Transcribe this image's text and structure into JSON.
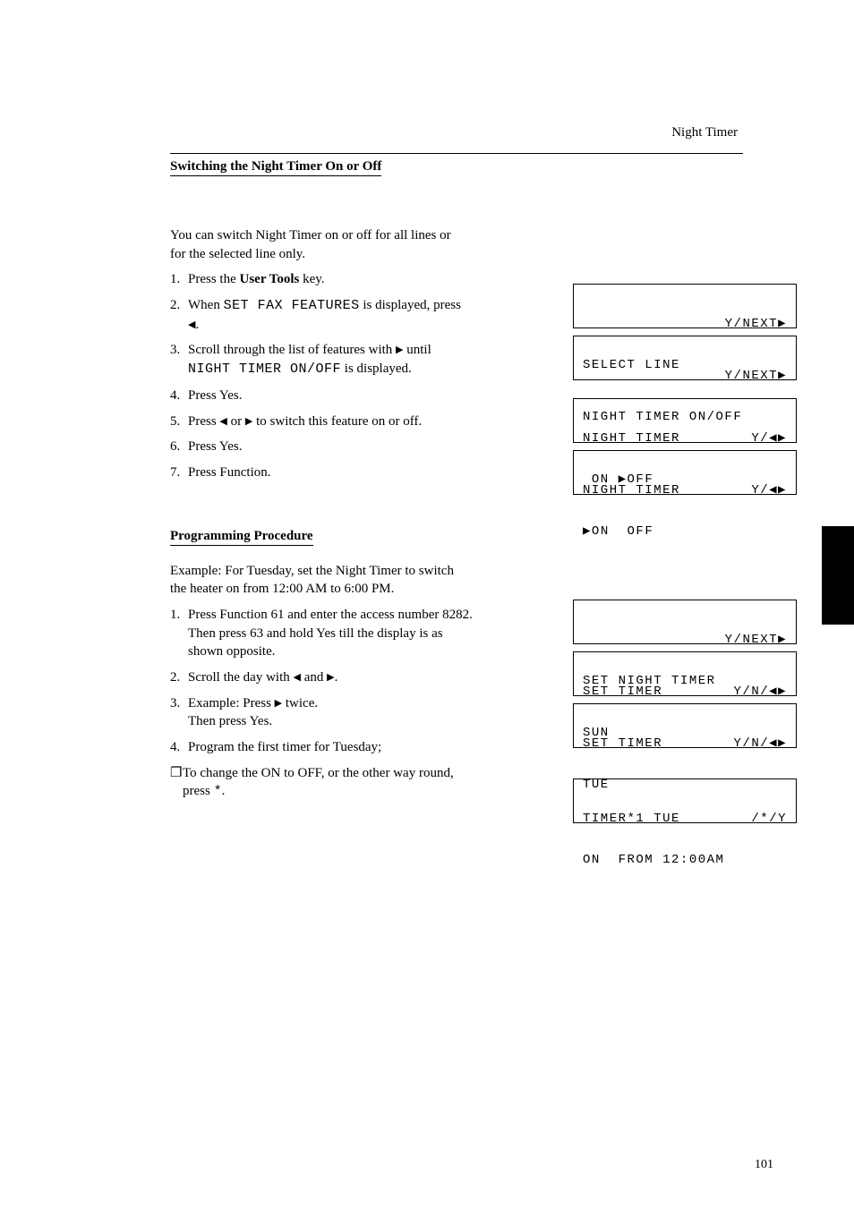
{
  "header": {
    "title": "Night Timer"
  },
  "section1": {
    "label": "Switching the Night Timer On or Off",
    "intro": "You can switch Night Timer on or off for all lines or for the selected line only.",
    "steps": [
      {
        "num": "1.",
        "text_before": "Press the ",
        "bold": "User Tools",
        "text_after": " key."
      },
      {
        "num": "2.",
        "text_pre": "When ",
        "mono": "SET FAX FEATURES",
        "text_mid": " is displayed, press ",
        "arrow": "◀",
        "text_post": "."
      },
      {
        "num": "3.",
        "s3a": "Scroll through the list of features with",
        "s3b": " until ",
        "s3mono": "NIGHT TIMER ON/OFF",
        "s3c": " is displayed."
      },
      {
        "num": "4.",
        "text": "Press Yes."
      },
      {
        "num": "5.",
        "pre": "Press ",
        "a1": "◀",
        "mid1": " or ",
        "a2": "▶",
        "post": " to switch this feature on or off."
      },
      {
        "num": "6.",
        "text": "Press Yes."
      },
      {
        "num": "7.",
        "text": "Press Function."
      }
    ]
  },
  "lcds1": [
    {
      "r1_right": "Y/NEXT▶",
      "r2_left": "SELECT LINE"
    },
    {
      "r1_right": "Y/NEXT▶",
      "r2_left": "NIGHT TIMER ON/OFF"
    },
    {
      "r1_left": "NIGHT TIMER",
      "r1_right": "Y/◀▶",
      "r2_left": " ON ▶OFF"
    },
    {
      "r1_left": "NIGHT TIMER",
      "r1_right": "Y/◀▶",
      "r2_left": "▶ON  OFF"
    }
  ],
  "section2": {
    "label": "Programming Procedure",
    "intro": "Example: For Tuesday, set the Night Timer to switch the heater on from 12:00 AM to 6:00 PM.",
    "steps": [
      {
        "num": "1.",
        "text": "Press Function 61 and enter the access number 8282. Then press 63 and hold Yes till the display is as shown opposite."
      },
      {
        "num": "2.",
        "pre": "Scroll the day with ",
        "a1": "◀",
        "mid": " and ",
        "a2": "▶",
        "post": "."
      },
      {
        "num": "3.",
        "pre": "Example: Press ",
        "a1": "▶",
        "post": " twice.",
        "then": "Then press Yes."
      },
      {
        "num": "4.",
        "text": "Program the first timer for Tuesday;"
      }
    ],
    "notes": [
      {
        "bullet": "❐",
        "pre": "To change the ON to OFF, or the other way round, press ",
        "mono": "*",
        "post": "."
      }
    ]
  },
  "lcds2": [
    {
      "r1_right": "Y/NEXT▶",
      "r2_left": "SET NIGHT TIMER"
    },
    {
      "r1_left": "SET TIMER",
      "r1_right": "Y/N/◀▶",
      "r2_left": "SUN"
    },
    {
      "r1_left": "SET TIMER",
      "r1_right": "Y/N/◀▶",
      "r2_left": "TUE"
    },
    {
      "r1_left": "TIMER*1 TUE",
      "r1_right": "/*/Y",
      "r2_left": "ON  FROM 12:00AM"
    }
  ],
  "footer": {
    "page": "101"
  }
}
